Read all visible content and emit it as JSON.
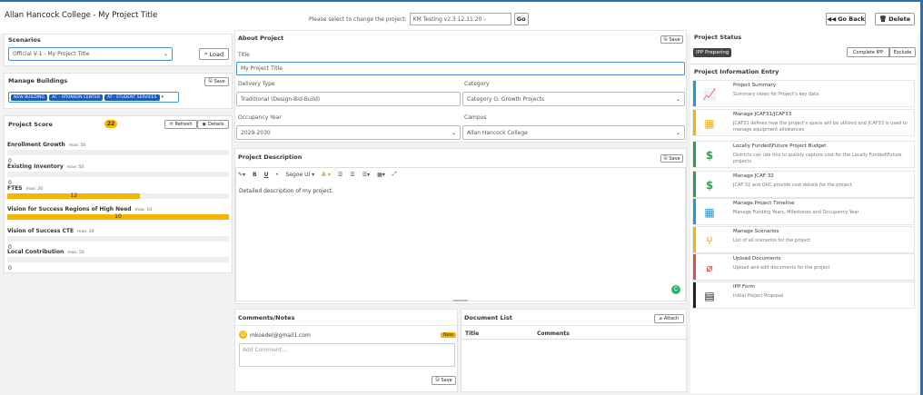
{
  "header": {
    "app_title": "Allan Hancock College - My Project Title",
    "select_label": "Please select to change the project:",
    "project_value": "KM Testing v2.3 12.11.20 -",
    "go_label": "Go",
    "back_label": "Go Back",
    "delete_label": "Delete"
  },
  "scenarios": {
    "title": "Scenarios",
    "selected": "Official V-1 - My Project Title",
    "load_label": "Load"
  },
  "buildings": {
    "title": "Manage Buildings",
    "save_label": "Save",
    "tags": [
      "NEW BUILDING",
      "AC - ATKINSON CENTER",
      "AT - STUDENT SERVICES"
    ]
  },
  "score": {
    "title": "Project Score",
    "total": "22",
    "refresh_label": "Refresh",
    "details_label": "Details",
    "items": [
      {
        "name": "Enrollment Growth",
        "max": "max: 50",
        "value": "0",
        "pct": 0
      },
      {
        "name": "Existing Inventory",
        "max": "max: 50",
        "value": "0",
        "pct": 0
      },
      {
        "name": "FTES",
        "max": "max: 20",
        "value": "12",
        "pct": 0.6
      },
      {
        "name": "Vision for Success Regions of High Need",
        "max": "max: 10",
        "value": "10",
        "pct": 1.0
      },
      {
        "name": "Vision of Success CTE",
        "max": "max: 20",
        "value": "0",
        "pct": 0
      },
      {
        "name": "Local Contribution",
        "max": "max: 50",
        "value": "0",
        "pct": 0
      }
    ]
  },
  "about": {
    "title": "About Project",
    "save_label": "Save",
    "title_label": "Title",
    "title_value": "My Project Title",
    "delivery_label": "Delivery Type",
    "delivery_value": "Traditional (Design-Bid-Build)",
    "category_label": "Category",
    "category_value": "Category G: Growth Projects",
    "occupancy_label": "Occupancy Year",
    "occupancy_value": "2029-2030",
    "campus_label": "Campus",
    "campus_value": "Allan Hancock College"
  },
  "description": {
    "title": "Project Description",
    "save_label": "Save",
    "font_name": "Segoe UI",
    "text": "Detailed description of my project."
  },
  "comments": {
    "title": "Comments/Notes",
    "user": "mkoedel@gmail1.com",
    "badge": "New",
    "placeholder": "Add Comment....",
    "save_label": "Save"
  },
  "documents": {
    "title": "Document List",
    "attach_label": "Attach",
    "col_title": "Title",
    "col_comments": "Comments"
  },
  "status": {
    "title": "Project Status",
    "badge": "IPP Preparing",
    "complete_label": "Complete IPP",
    "exclude_label": "Exclude",
    "entry_title": "Project Information Entry"
  },
  "entries": [
    {
      "title": "Project Summary",
      "desc": "Summary views for Project's key data",
      "icon": "chart-line-icon",
      "glyph": "📈",
      "color": "#1a9cd8"
    },
    {
      "title": "Manage JCAF31/JCAF33",
      "desc": "JCAF31 defines how the project's space will be utilized and JCAF33 is used to manage equipment allowances",
      "icon": "building-icon",
      "glyph": "▦",
      "color": "#f4b400"
    },
    {
      "title": "Locally Funded\\Future Project Budget",
      "desc": "Districts can use this to quickly capture cost for the Locally Funded\\Future projects",
      "icon": "dollar-icon",
      "glyph": "$",
      "color": "#2e9e4f"
    },
    {
      "title": "Manage JCAF 32",
      "desc": "JCAF 32 and QUC provide cost details for the project.",
      "icon": "dollar-icon",
      "glyph": "$",
      "color": "#2e9e4f"
    },
    {
      "title": "Manage Project Timeline",
      "desc": "Manage Funding Years, Milestones and Occupancy Year",
      "icon": "calendar-icon",
      "glyph": "▦",
      "color": "#1a9cd8"
    },
    {
      "title": "Manage Scenarios",
      "desc": "List of all scenarios for the project",
      "icon": "branch-icon",
      "glyph": "⑂",
      "color": "#f4b400"
    },
    {
      "title": "Upload Documents",
      "desc": "Upload and edit documents for the project",
      "icon": "paperclip-icon",
      "glyph": "⌀",
      "color": "#d9534f"
    },
    {
      "title": "IPP Form",
      "desc": "Initial Project Proposal",
      "icon": "file-icon",
      "glyph": "▤",
      "color": "#222"
    }
  ]
}
